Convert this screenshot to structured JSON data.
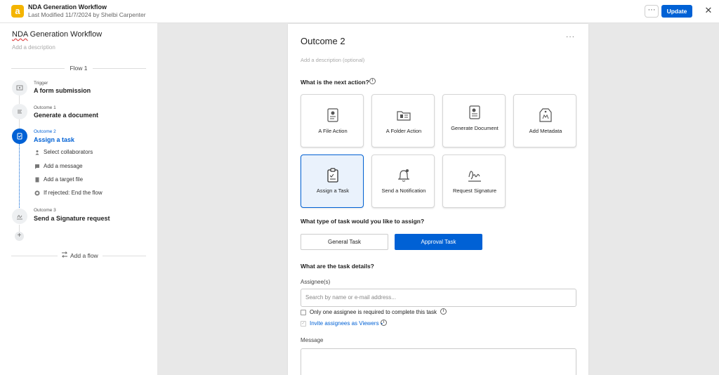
{
  "header": {
    "logo_char": "a",
    "title": "NDA Generation Workflow",
    "subtitle": "Last Modified 11/7/2024 by Shelbi Carpenter",
    "more_label": "···",
    "update_label": "Update",
    "close_label": "✕"
  },
  "sidebar": {
    "title_prefix": "NDA",
    "title_rest": " Generation Workflow",
    "description_placeholder": "Add a description",
    "flow_label": "Flow 1",
    "steps": [
      {
        "small": "Trigger",
        "main": "A form submission",
        "icon": "form-icon"
      },
      {
        "small": "Outcome 1",
        "main": "Generate a document",
        "icon": "document-icon"
      },
      {
        "small": "Outcome 2",
        "main": "Assign a task",
        "icon": "task-icon"
      },
      {
        "small": "Outcome 3",
        "main": "Send a Signature request",
        "icon": "signature-icon"
      }
    ],
    "substeps": [
      {
        "label": "Select collaborators",
        "icon": "person-icon"
      },
      {
        "label": "Add a message",
        "icon": "message-icon"
      },
      {
        "label": "Add a target file",
        "icon": "file-icon"
      },
      {
        "label": "If rejected: End the flow",
        "icon": "stop-icon"
      }
    ],
    "add_step_label": "+",
    "add_flow_label": "Add a flow"
  },
  "main": {
    "title": "Outcome 2",
    "more_label": "···",
    "description_placeholder": "Add a description (optional)",
    "next_action_question": "What is the next action?",
    "actions": [
      {
        "label": "A File Action",
        "icon": "file-action-icon"
      },
      {
        "label": "A Folder Action",
        "icon": "folder-action-icon"
      },
      {
        "label": "Generate Document",
        "icon": "generate-document-icon"
      },
      {
        "label": "Add Metadata",
        "icon": "metadata-icon"
      },
      {
        "label": "Assign a Task",
        "icon": "assign-task-icon",
        "selected": true
      },
      {
        "label": "Send a Notification",
        "icon": "notification-icon"
      },
      {
        "label": "Request Signature",
        "icon": "signature-icon"
      }
    ],
    "task_type_question": "What type of task would you like to assign?",
    "task_types": {
      "general": "General Task",
      "approval": "Approval Task",
      "selected": "approval"
    },
    "details_question": "What are the task details?",
    "assignees_label": "Assignee(s)",
    "assignees_placeholder": "Search by name or e-mail address...",
    "only_one_label": "Only one assignee is required to complete this task",
    "invite_label": "Invite assignees as Viewers",
    "message_label": "Message"
  },
  "colors": {
    "accent": "#0061d5",
    "logo": "#f4b400"
  }
}
